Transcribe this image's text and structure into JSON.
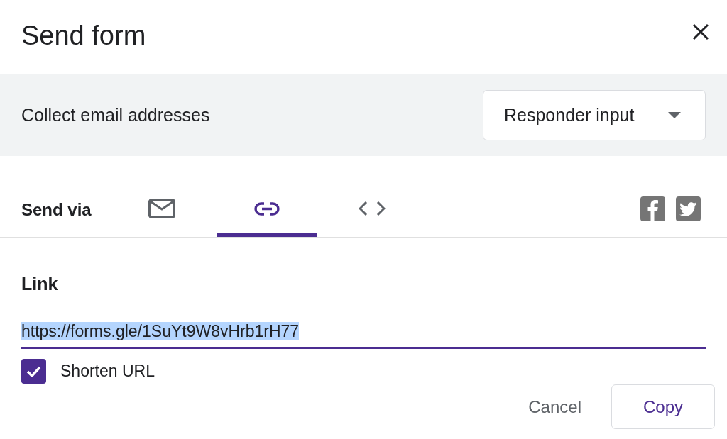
{
  "dialog": {
    "title": "Send form"
  },
  "collect_email": {
    "label": "Collect email addresses",
    "dropdown": {
      "value": "Responder input"
    }
  },
  "send_via": {
    "label": "Send via",
    "tabs": [
      {
        "kind": "email",
        "selected": false
      },
      {
        "kind": "link",
        "selected": true
      },
      {
        "kind": "embed",
        "selected": false
      }
    ],
    "share": [
      {
        "kind": "facebook"
      },
      {
        "kind": "twitter"
      }
    ]
  },
  "link": {
    "heading": "Link",
    "url": "https://forms.gle/1SuYt9W8vHrb1rH77",
    "text_selected": true,
    "shorten_url": {
      "label": "Shorten URL",
      "checked": true
    }
  },
  "buttons": [
    {
      "label": "Cancel",
      "kind": "text"
    },
    {
      "label": "Copy",
      "kind": "outlined"
    }
  ]
}
